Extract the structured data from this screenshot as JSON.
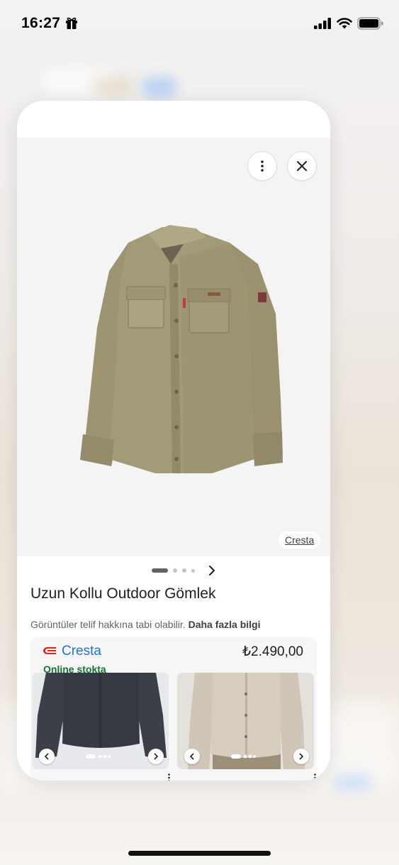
{
  "status_bar": {
    "time": "16:27",
    "icons": [
      "gift-icon",
      "cellular-signal-icon",
      "wifi-icon",
      "battery-icon"
    ]
  },
  "product_card": {
    "buttons": {
      "more_icon": "more-vert-icon",
      "close_icon": "close-icon"
    },
    "image_source": "Cresta",
    "carousel": {
      "page_count": 4,
      "active_index": 0,
      "next_icon": "chevron-right-icon"
    },
    "title": "Uzun Kollu Outdoor Gömlek",
    "copyright_text": "Görüntüler telif hakkına tabi olabilir.",
    "more_info_link": "Daha fazla bilgi",
    "offer": {
      "merchant": "Cresta",
      "price": "₺2.490,00",
      "stock_status": "Online stokta"
    }
  },
  "colors": {
    "link_blue": "#1a73e8",
    "in_stock_green": "#137333",
    "text_primary": "#202124",
    "text_secondary": "#5f6368",
    "image_bg": "#f4f4f5",
    "shirt_khaki": "#a39a78"
  }
}
